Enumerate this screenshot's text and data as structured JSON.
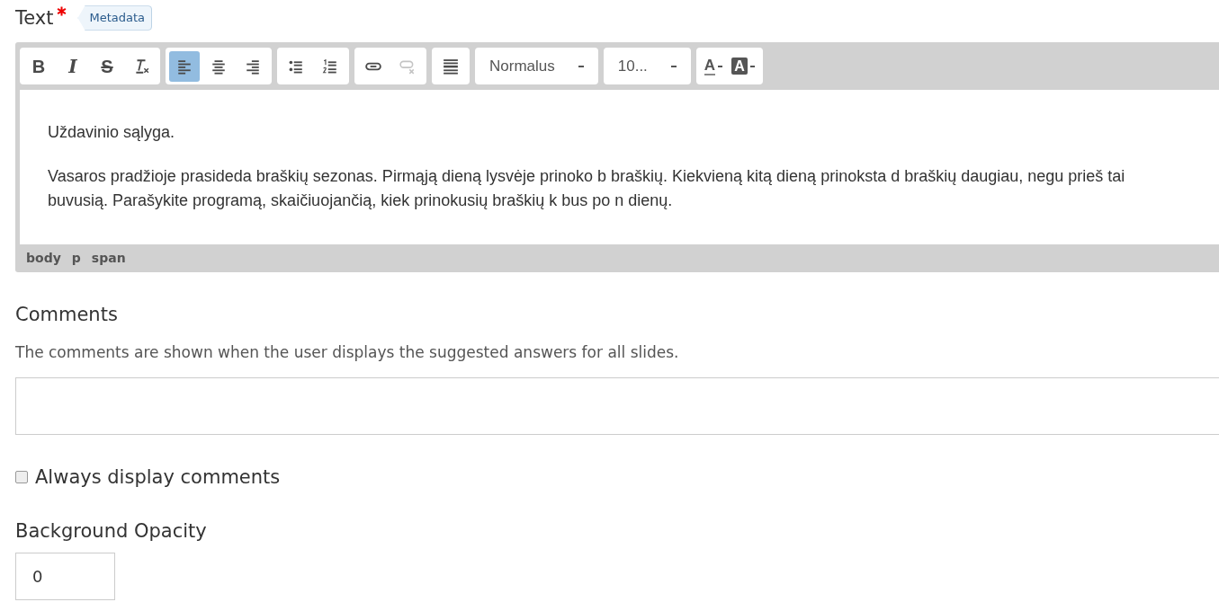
{
  "field": {
    "label": "Text",
    "required": true,
    "badge": "Metadata"
  },
  "toolbar": {
    "groups": [
      [
        {
          "kind": "bold",
          "label": "B"
        },
        {
          "kind": "italic",
          "label": "I"
        },
        {
          "kind": "strike",
          "label": "S"
        },
        {
          "kind": "remove-format"
        }
      ],
      [
        {
          "kind": "align-left",
          "selected": true
        },
        {
          "kind": "align-center",
          "selected": false
        },
        {
          "kind": "align-right",
          "selected": false
        }
      ],
      [
        {
          "kind": "bullet-list"
        },
        {
          "kind": "numbered-list"
        }
      ],
      [
        {
          "kind": "link",
          "disabled": false
        },
        {
          "kind": "unlink",
          "disabled": true
        }
      ],
      [
        {
          "kind": "rule"
        }
      ]
    ],
    "dropdowns": [
      {
        "value": "Normalus"
      },
      {
        "value": "10..."
      }
    ],
    "colors": [
      {
        "kind": "text-color",
        "label": "A"
      },
      {
        "kind": "background-color",
        "label": "A"
      }
    ]
  },
  "content": [
    "Uždavinio sąlyga.",
    "Vasaros pradžioje prasideda braškių sezonas. Pirmąją dieną lysvėje prinoko b braškių. Kiekvieną kitą dieną prinoksta d braškių daugiau, negu prieš tai buvusią. Parašykite programą, skaičiuojančią, kiek prinokusių braškių k bus po n dienų."
  ],
  "path": [
    "body",
    "p",
    "span"
  ],
  "comments": {
    "label": "Comments",
    "description": "The comments are shown when the user displays the suggested answers for all slides."
  },
  "always_display": {
    "label": "Always display comments",
    "checked": false
  },
  "opacity": {
    "label": "Background Opacity",
    "value": "0"
  }
}
